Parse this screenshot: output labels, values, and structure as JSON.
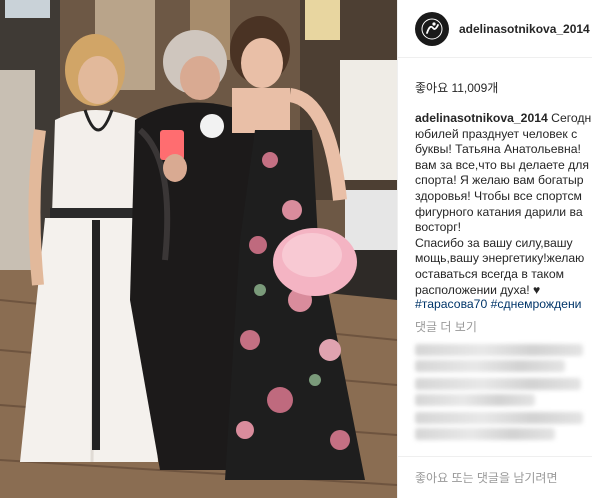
{
  "post": {
    "username": "adelinasotnikova_2014",
    "likes_text": "좋아요 11,009개",
    "caption_user": "adelinasotnikova_2014",
    "caption_text": " Сегодн\nюбилей празднует человек с\nбуквы! Татьяна Анатольевна!\nвам за все,что вы делаете для\nспорта! Я желаю вам богатыр\nздоровья! Чтобы все спортсм\nфигурного катания дарили ва\nвосторг!\nСпасибо за вашу силу,вашу\nмощь,вашу энергетику!желаю\nоставаться всегда в таком\nрасположении духа! ♥",
    "hashtags": "#тарасова70 #сднемрождени",
    "more_comments": "댓글 더 보기",
    "comment_placeholder": "좋아요 또는 댓글을 남기려면"
  },
  "icons": {
    "avatar": "skater-logo-icon"
  }
}
